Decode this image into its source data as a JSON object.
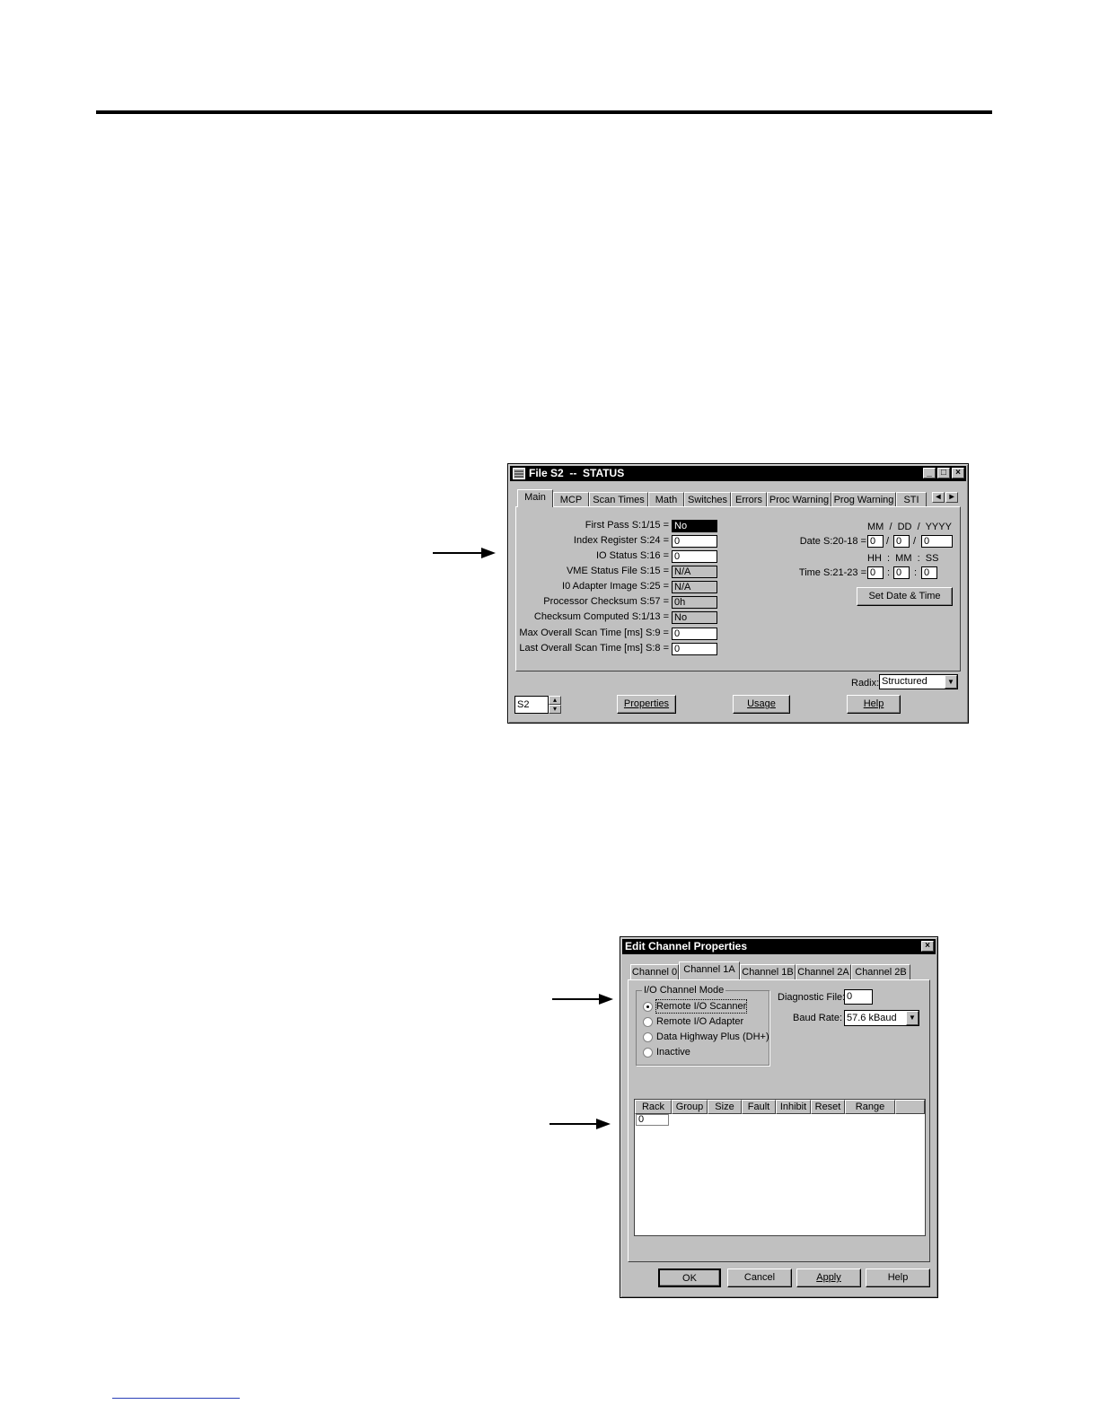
{
  "status_window": {
    "title": "File S2  --  STATUS",
    "tabs": [
      "Main",
      "MCP",
      "Scan Times",
      "Math",
      "Switches",
      "Errors",
      "Proc Warning",
      "Prog Warning",
      "STI"
    ],
    "fields": [
      {
        "label": "First Pass S:1/15 =",
        "value": "No"
      },
      {
        "label": "Index Register S:24 =",
        "value": "0"
      },
      {
        "label": "IO Status S:16 =",
        "value": "0"
      },
      {
        "label": "VME Status File S:15 =",
        "value": "N/A"
      },
      {
        "label": "I0 Adapter Image S:25 =",
        "value": "N/A"
      },
      {
        "label": "Processor Checksum S:57 =",
        "value": "0h"
      },
      {
        "label": "Checksum Computed S:1/13 =",
        "value": "No"
      },
      {
        "label": "Max Overall Scan Time  [ms] S:9 =",
        "value": "0"
      },
      {
        "label": "Last Overall Scan Time  [ms] S:8 =",
        "value": "0"
      }
    ],
    "date_header": "MM  /  DD  /  YYYY",
    "date_label": "Date S:20-18 =",
    "date_values": [
      "0",
      "0",
      "0"
    ],
    "time_header": "HH  :  MM  :  SS",
    "time_label": "Time S:21-23 =",
    "time_values": [
      "0",
      "0",
      "0"
    ],
    "set_date_button": "Set Date & Time",
    "radix_label": "Radix:",
    "radix_value": "Structured",
    "file_selector_value": "S2",
    "properties_button": "Properties",
    "usage_button": "Usage",
    "help_button": "Help"
  },
  "channel_window": {
    "title": "Edit Channel Properties",
    "tabs": [
      "Channel 0",
      "Channel 1A",
      "Channel 1B",
      "Channel 2A",
      "Channel 2B"
    ],
    "mode_group_label": "I/O Channel Mode",
    "modes": [
      "Remote I/O Scanner",
      "Remote I/O Adapter",
      "Data Highway Plus (DH+)",
      "Inactive"
    ],
    "diagnostic_label": "Diagnostic File:",
    "diagnostic_value": "0",
    "baud_label": "Baud Rate:",
    "baud_value": "57.6 kBaud",
    "columns": [
      "Rack",
      "Group",
      "Size",
      "Fault",
      "Inhibit",
      "Reset",
      "Range"
    ],
    "first_cell": "0",
    "buttons": {
      "ok": "OK",
      "cancel": "Cancel",
      "apply": "Apply",
      "help": "Help"
    }
  }
}
